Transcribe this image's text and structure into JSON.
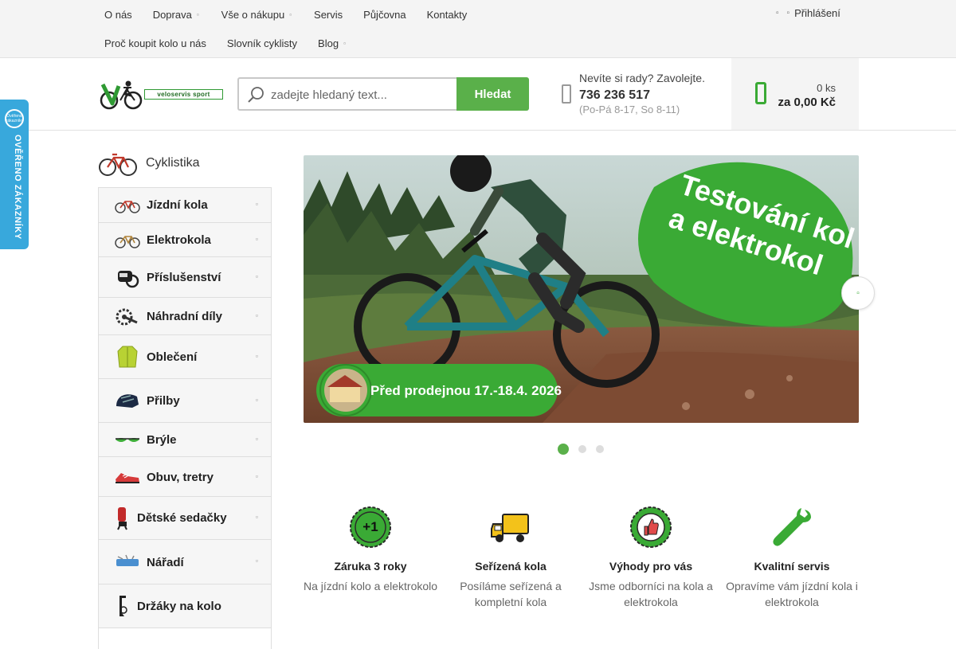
{
  "nav": {
    "row1": [
      {
        "label": "O nás",
        "dropdown": false
      },
      {
        "label": "Doprava",
        "dropdown": true
      },
      {
        "label": "Vše o nákupu",
        "dropdown": true
      },
      {
        "label": "Servis",
        "dropdown": false
      },
      {
        "label": "Půjčovna",
        "dropdown": false
      },
      {
        "label": "Kontakty",
        "dropdown": false
      }
    ],
    "row2": [
      {
        "label": "Proč koupit kolo u nás",
        "dropdown": false
      },
      {
        "label": "Slovník cyklisty",
        "dropdown": false
      },
      {
        "label": "Blog",
        "dropdown": true
      }
    ],
    "login_label": "Přihlášení",
    "caret_glyph": "▫"
  },
  "logo": {
    "text": "veloservis sport",
    "colors": {
      "green": "#2f9a33",
      "dark": "#1e6a20"
    }
  },
  "search": {
    "placeholder": "zadejte hledaný text...",
    "button_label": "Hledat"
  },
  "contact": {
    "question": "Nevíte si rady? Zavolejte.",
    "phone": "736 236 517",
    "hours": "(Po-Pá 8-17, So 8-11)"
  },
  "cart": {
    "count": "0 ks",
    "total": "za 0,00 Kč"
  },
  "badge": {
    "text": "OVĚŘENO ZÁKAZNÍKY",
    "seal_text": "Ověřeno zákazníky",
    "color": "#38a8dc"
  },
  "sidebar": {
    "heading": "Cyklistika",
    "items": [
      {
        "label": "Jízdní kola",
        "icon": "bike-icon"
      },
      {
        "label": "Elektrokola",
        "icon": "ebike-icon"
      },
      {
        "label": "Příslušenství",
        "icon": "bike-light-icon"
      },
      {
        "label": "Náhradní díly",
        "icon": "crankset-icon"
      },
      {
        "label": "Oblečení",
        "icon": "jacket-icon"
      },
      {
        "label": "Přilby",
        "icon": "helmet-icon"
      },
      {
        "label": "Brýle",
        "icon": "glasses-icon"
      },
      {
        "label": "Obuv, tretry",
        "icon": "shoe-icon"
      },
      {
        "label": "Dětské sedačky",
        "icon": "child-seat-icon"
      },
      {
        "label": "Nářadí",
        "icon": "tool-icon"
      },
      {
        "label": "Držáky na kolo",
        "icon": "bike-holder-icon"
      }
    ]
  },
  "banner": {
    "headline_line1": "Testování kol",
    "headline_line2": "a elektrokol",
    "subline": "Před prodejnou 17.-18.4. 2026",
    "slides": 3,
    "active_slide": 1
  },
  "features": [
    {
      "title": "Záruka 3 roky",
      "desc": "Na jízdní kolo a elektrokolo",
      "icon": "warranty-plus-one-icon"
    },
    {
      "title": "Seřízená kola",
      "desc": "Posíláme seřízená a kompletní kola",
      "icon": "delivery-truck-icon"
    },
    {
      "title": "Výhody pro vás",
      "desc": "Jsme odborníci na kola a elektrokola",
      "icon": "thumbs-up-badge-icon"
    },
    {
      "title": "Kvalitní servis",
      "desc": "Opravíme vám jízdní kola i elektrokola",
      "icon": "wrench-icon"
    }
  ],
  "colors": {
    "brand_green": "#5ab04a",
    "accent_green": "#3aaa35",
    "badge_blue": "#38a8dc"
  }
}
